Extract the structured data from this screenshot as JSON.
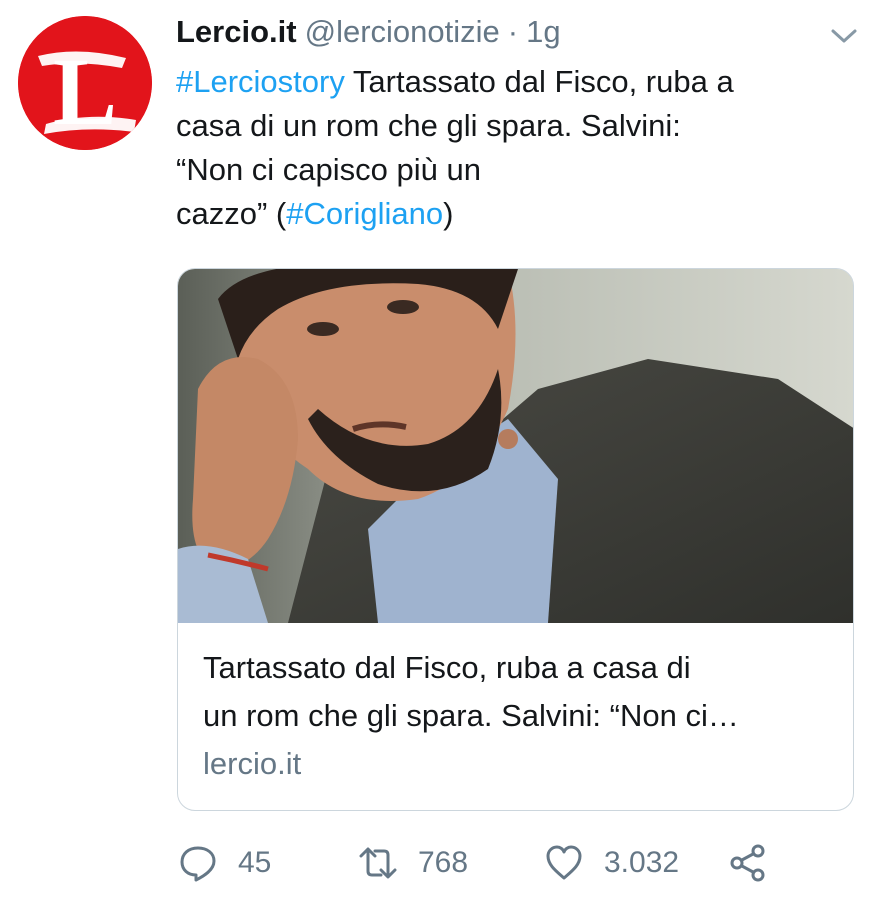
{
  "tweet": {
    "display_name": "Lercio.it",
    "handle": "@lercionotizie",
    "separator": "·",
    "time": "1g",
    "text": {
      "line1_hashtag": "#Lerciostory",
      "line1_text": " Tartassato dal Fisco, ruba a",
      "line2": "casa di un rom che gli spara. Salvini:",
      "line3": "“Non ci capisco più un",
      "line4_text": "cazzo” (",
      "line4_hashtag": "#Corigliano",
      "line4_end": ")"
    },
    "avatar_letter": "L",
    "brand_color": "#e2141b",
    "hashtag_color": "#1da1f2",
    "icons": {
      "menu": "chevron-down-icon",
      "reply": "reply-icon",
      "retweet": "retweet-icon",
      "like": "heart-icon",
      "share": "share-icon"
    }
  },
  "card": {
    "title_line1": "Tartassato dal Fisco, ruba a casa di",
    "title_line2": "un rom che gli spara. Salvini: “Non ci…",
    "domain": "lercio.it"
  },
  "actions": {
    "replies": "45",
    "retweets": "768",
    "likes": "3.032"
  }
}
